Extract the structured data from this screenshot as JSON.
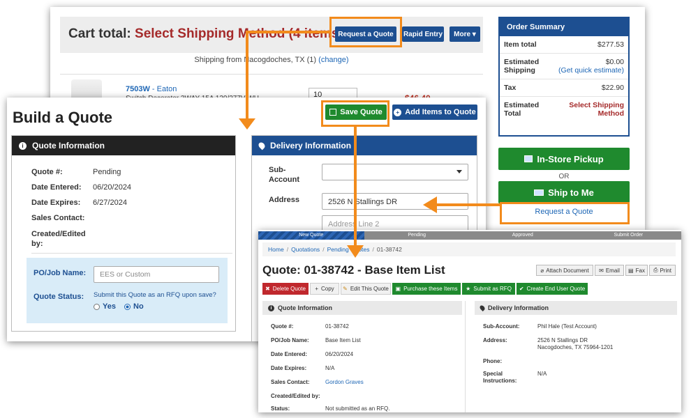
{
  "cart": {
    "title_prefix": "Cart total:",
    "title_accent": "Select Shipping Method (4 items)",
    "request_quote": "Request a Quote",
    "rapid_entry": "Rapid Entry",
    "more": "More ▾",
    "shipping_from": "Shipping from Nacogdoches, TX (1)",
    "change": "(change)",
    "product_sku": "7503W",
    "product_brand": "- Eaton",
    "product_desc": "Switch Decorator 3WAY 15A 120/277V WH",
    "product_qty": "10",
    "product_price": "$46.40"
  },
  "summary": {
    "header": "Order Summary",
    "rows": [
      {
        "k": "Item total",
        "v": "$277.53"
      },
      {
        "k": "Estimated Shipping",
        "v": "$0.00",
        "link": "(Get quick estimate)"
      },
      {
        "k": "Tax",
        "v": "$22.90"
      },
      {
        "k": "Estimated Total",
        "v": "Select Shipping Method"
      }
    ],
    "instore": "In-Store Pickup",
    "or": "OR",
    "shiptome": "Ship to Me",
    "request_quote_link": "Request a Quote"
  },
  "build": {
    "title": "Build a Quote",
    "save": "Save Quote",
    "add_items": "Add Items to Quote",
    "quote_info_header": "Quote Information",
    "fields": [
      {
        "k": "Quote #:",
        "v": "Pending"
      },
      {
        "k": "Date Entered:",
        "v": "06/20/2024"
      },
      {
        "k": "Date Expires:",
        "v": "6/27/2024"
      },
      {
        "k": "Sales Contact:",
        "v": ""
      },
      {
        "k": "Created/Edited by:",
        "v": ""
      }
    ],
    "po_label": "PO/Job Name:",
    "po_placeholder": "EES or Custom",
    "status_label": "Quote Status:",
    "rfq_question": "Submit this Quote as an RFQ upon save?",
    "yes": "Yes",
    "no": "No",
    "delivery_header": "Delivery Information",
    "sub_account_label": "Sub-Account",
    "address_label": "Address",
    "address_value": "2526 N Stallings DR",
    "address2_placeholder": "Address Line 2"
  },
  "detail": {
    "steps": [
      "New Quote",
      "Pending",
      "Approved",
      "Submit Order"
    ],
    "crumbs": [
      "Home",
      "Quotations",
      "Pending Quotes",
      "01-38742"
    ],
    "title": "Quote: 01-38742 - Base Item List",
    "tools": [
      "Attach Document",
      "Email",
      "Fax",
      "Print"
    ],
    "actions": [
      "Delete Quote",
      "Copy",
      "Edit This Quote",
      "Purchase these Items",
      "Submit as RFQ",
      "Create End User Quote"
    ],
    "quote_info_header": "Quote Information",
    "delivery_header": "Delivery Information",
    "left_rows": [
      {
        "k": "Quote #:",
        "v": "01-38742"
      },
      {
        "k": "PO/Job Name:",
        "v": "Base Item List"
      },
      {
        "k": "Date Entered:",
        "v": "06/20/2024"
      },
      {
        "k": "Date Expires:",
        "v": "N/A"
      },
      {
        "k": "Sales Contact:",
        "v": "Gordon Graves"
      },
      {
        "k": "Created/Edited by:",
        "v": ""
      },
      {
        "k": "Status:",
        "v": "Not submitted as an RFQ."
      }
    ],
    "right_rows": [
      {
        "k": "Sub-Account:",
        "v": "Phil Hale (Test Account)"
      },
      {
        "k": "Address:",
        "v": "2526 N Stallings DR",
        "v2": "Nacogdoches, TX 75964-1201"
      },
      {
        "k": "Phone:",
        "v": ""
      },
      {
        "k": "Special Instructions:",
        "v": "N/A"
      }
    ]
  },
  "colors": {
    "accent_orange": "#f28b1c",
    "navy": "#1d4f91",
    "green": "#1f8a2e",
    "red_accent": "#a52a2a"
  }
}
